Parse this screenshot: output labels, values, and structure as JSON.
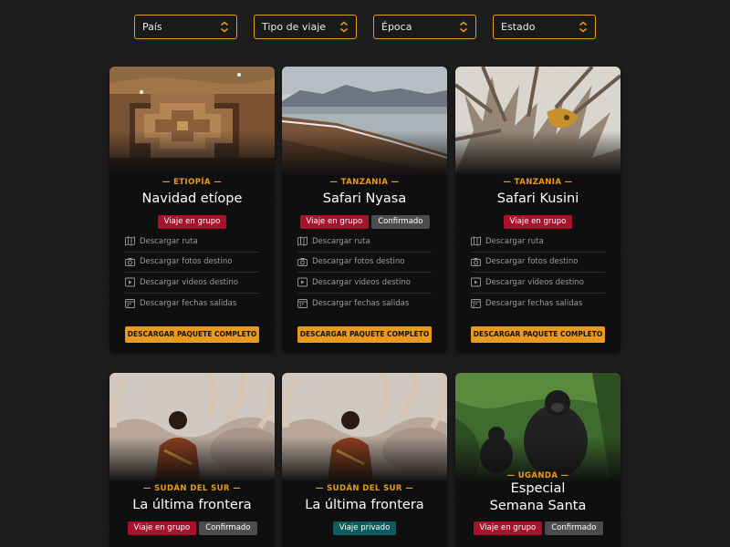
{
  "filters": [
    {
      "label": "País"
    },
    {
      "label": "Tipo de viaje"
    },
    {
      "label": "Época"
    },
    {
      "label": "Estado"
    }
  ],
  "cards": [
    {
      "country": "— ETIOPÍA —",
      "title": "Navidad etíope",
      "tags": [
        "Viaje en grupo"
      ],
      "tag_styles": [
        "red"
      ],
      "image": "lalibela-rock-church"
    },
    {
      "country": "— TANZANIA —",
      "title": "Safari Nyasa",
      "tags": [
        "Viaje en grupo",
        "Confirmado"
      ],
      "tag_styles": [
        "red",
        "grey"
      ],
      "image": "lake-nyasa-beach"
    },
    {
      "country": "— TANZANIA —",
      "title": "Safari Kusini",
      "tags": [
        "Viaje en grupo"
      ],
      "tag_styles": [
        "red"
      ],
      "image": "leopard-in-tree"
    },
    {
      "country": "— SUDÁN DEL SUR —",
      "title": "La última frontera",
      "tags": [
        "Viaje en grupo",
        "Confirmado"
      ],
      "tag_styles": [
        "red",
        "grey"
      ],
      "image": "herder-with-cattle"
    },
    {
      "country": "— SUDÁN DEL SUR —",
      "title": "La última frontera",
      "tags": [
        "Viaje privado"
      ],
      "tag_styles": [
        "teal"
      ],
      "image": "herder-with-cattle"
    },
    {
      "country": "— UGANDA —",
      "title": "Especial\nSemana Santa",
      "tags": [
        "Viaje en grupo",
        "Confirmado"
      ],
      "tag_styles": [
        "red",
        "grey"
      ],
      "image": "gorillas"
    }
  ],
  "downloads": [
    {
      "label": "Descargar ruta",
      "icon": "map-icon"
    },
    {
      "label": "Descargar fotos destino",
      "icon": "camera-icon"
    },
    {
      "label": "Descargar videos destino",
      "icon": "play-icon"
    },
    {
      "label": "Descargar fechas salidas",
      "icon": "calendar-icon"
    }
  ],
  "cta_label": "DESCARGAR PAQUETE COMPLETO",
  "colors": {
    "accent": "#e99a1d",
    "group_tag": "#a8122e",
    "confirmed_tag": "#4c4c4e",
    "private_tag": "#0f5c5f",
    "card_bg": "#0f0f10"
  }
}
